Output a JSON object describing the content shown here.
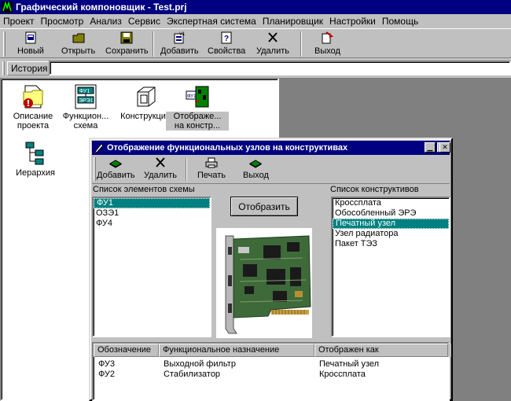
{
  "window": {
    "title": "Графический компоновщик - Test.prj"
  },
  "menu": [
    "Проект",
    "Просмотр",
    "Анализ",
    "Сервис",
    "Экспертная система",
    "Планировщик",
    "Настройки",
    "Помощь"
  ],
  "toolbar": {
    "new": "Новый",
    "open": "Открыть",
    "save": "Сохранить",
    "add": "Добавить",
    "properties": "Свойства",
    "delete": "Удалить",
    "exit": "Выход"
  },
  "history": {
    "label": "История",
    "value": ""
  },
  "explorer": {
    "items": [
      {
        "line1": "Описание",
        "line2": "проекта"
      },
      {
        "line1": "Функцион...",
        "line2": "схема"
      },
      {
        "line1": "Конструкция",
        "line2": ""
      },
      {
        "line1": "Отображе...",
        "line2": "на констр..."
      },
      {
        "line1": "Иерархия",
        "line2": ""
      }
    ]
  },
  "dialog": {
    "title": "Отображение функциональных узлов на конструктивах",
    "toolbar": {
      "add": "Добавить",
      "delete": "Удалить",
      "print": "Печать",
      "exit": "Выход"
    },
    "elements_label": "Список элементов схемы",
    "elements": [
      "ФУ1",
      "ОЗЭ1",
      "ФУ4"
    ],
    "elements_selected_index": 0,
    "show_button": "Отобразить",
    "constructives_label": "Список конструктивов",
    "constructives": [
      "Кроссплата",
      "Обособленный ЭРЭ",
      "Печатный узел",
      "Узел радиатора",
      "Пакет ТЭЗ"
    ],
    "constructives_selected_index": 2,
    "table": {
      "columns": [
        "Обозначение",
        "Функциональное назначение",
        "Отображен как"
      ],
      "rows": [
        [
          "ФУ3",
          "Выходной фильтр",
          "Печатный узел"
        ],
        [
          "ФУ2",
          "Стабилизатор",
          "Кроссплата"
        ]
      ]
    }
  },
  "colors": {
    "titlebar": "#000080",
    "selection": "#008080",
    "face": "#c0c0c0",
    "workspace": "#808080"
  }
}
